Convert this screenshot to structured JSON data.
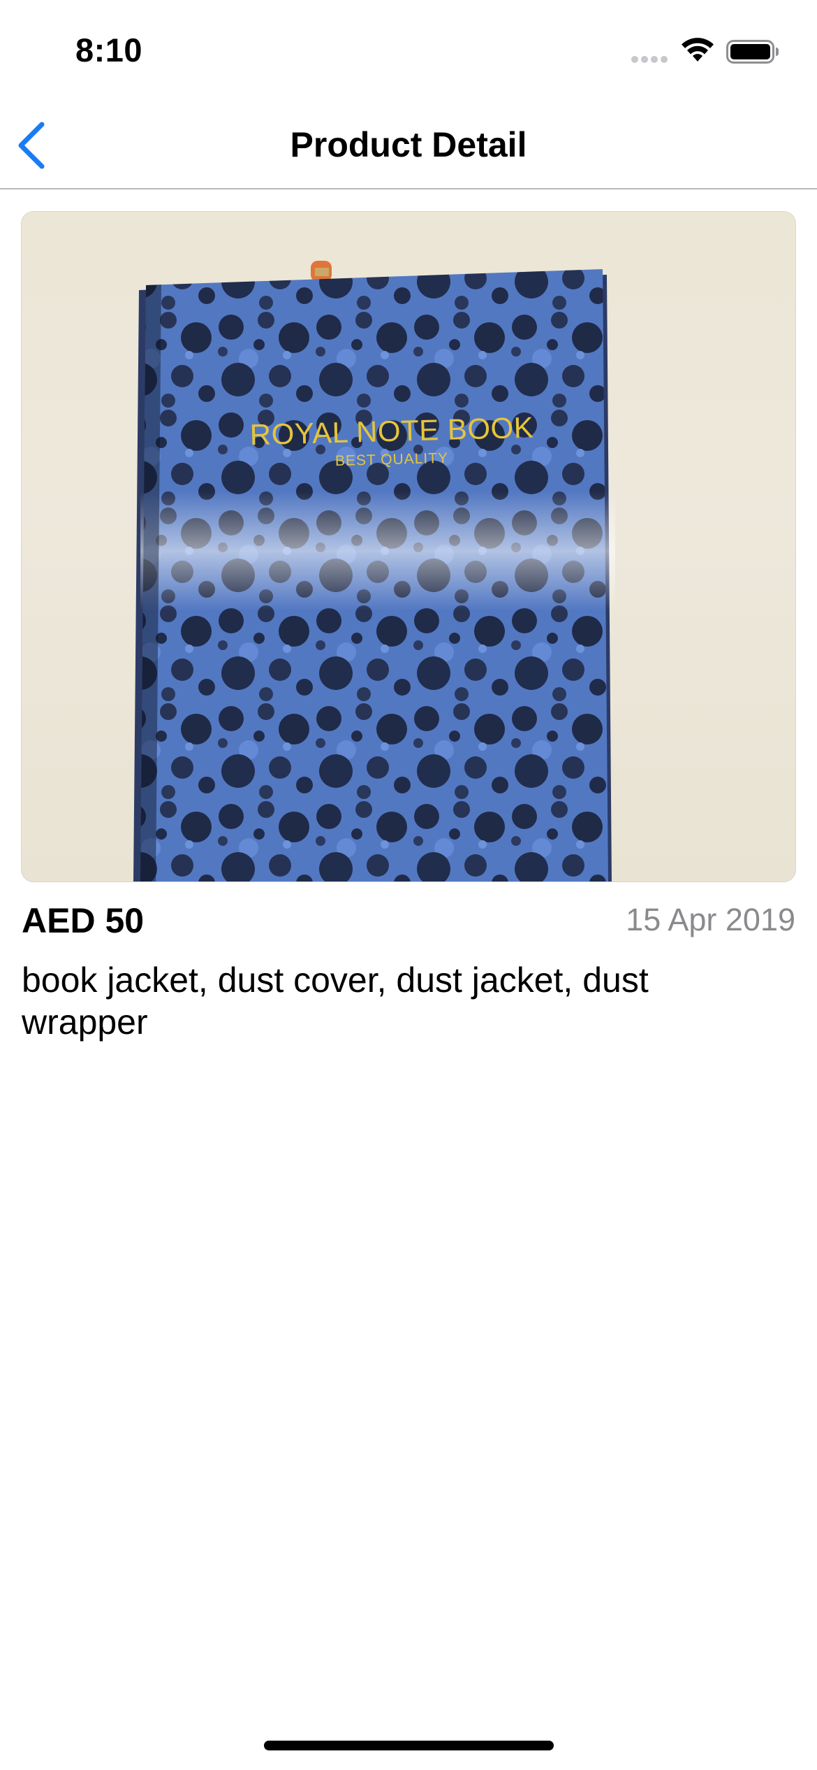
{
  "status_bar": {
    "time": "8:10",
    "icons": [
      "signal-dots-icon",
      "wifi-icon",
      "battery-icon"
    ]
  },
  "nav": {
    "title": "Product Detail",
    "back_icon": "chevron-left-icon",
    "accent_color": "#1a7cf5"
  },
  "product": {
    "image": {
      "subject": "blue marbled notebook",
      "cover_title": "ROYAL NOTE BOOK",
      "cover_subtitle": "BEST QUALITY"
    },
    "price": "AED 50",
    "date": "15 Apr 2019",
    "description": "book jacket, dust cover, dust jacket, dust wrapper"
  }
}
